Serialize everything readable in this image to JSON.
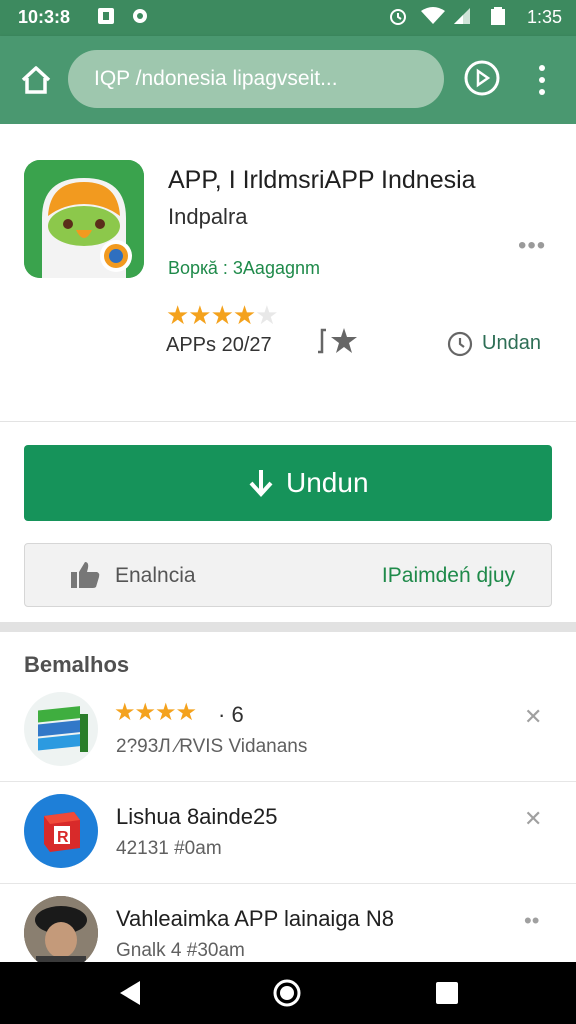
{
  "status_bar": {
    "time_left": "10:3:8",
    "time_right": "1:35",
    "icons": [
      "notification-icon",
      "settings-icon",
      "alarm-icon",
      "wifi-icon",
      "signal-icon",
      "battery-icon"
    ]
  },
  "toolbar": {
    "url_text": "IQP /ndonesia lipagvseit...",
    "icons": [
      "home-icon",
      "play-icon",
      "overflow-menu-icon"
    ]
  },
  "app": {
    "title": "APP, I IrldmsriAPP Indnesia",
    "subtitle": "Indpalra",
    "developer": "Bopкă : 3Aagagnm",
    "stars_filled": "★★★★",
    "stars_empty": "★",
    "rating_text": "APPs 20/27",
    "download_label": "Undan",
    "more": "•••"
  },
  "actions": {
    "install_label": "Undun",
    "like_label": "Enalncia",
    "review_label": "IPaimdeń djuy"
  },
  "section": {
    "title": "Bemalhos"
  },
  "list": [
    {
      "stars": "★★★★",
      "count": "· 6",
      "subtitle": "2?93Л ⁄RVIS Vidanans",
      "action": "✕"
    },
    {
      "title": "Lishua 8ainde25",
      "subtitle": "42131 #0am",
      "action": "✕"
    },
    {
      "title": "Vahleaimka APP lainaiga N8",
      "subtitle": "Gnalk 4 #30am",
      "action": "••"
    }
  ],
  "colors": {
    "status_bar": "#3d8a5f",
    "toolbar": "#4a9870",
    "accent_green": "#16935a",
    "star": "#f4a21d"
  }
}
